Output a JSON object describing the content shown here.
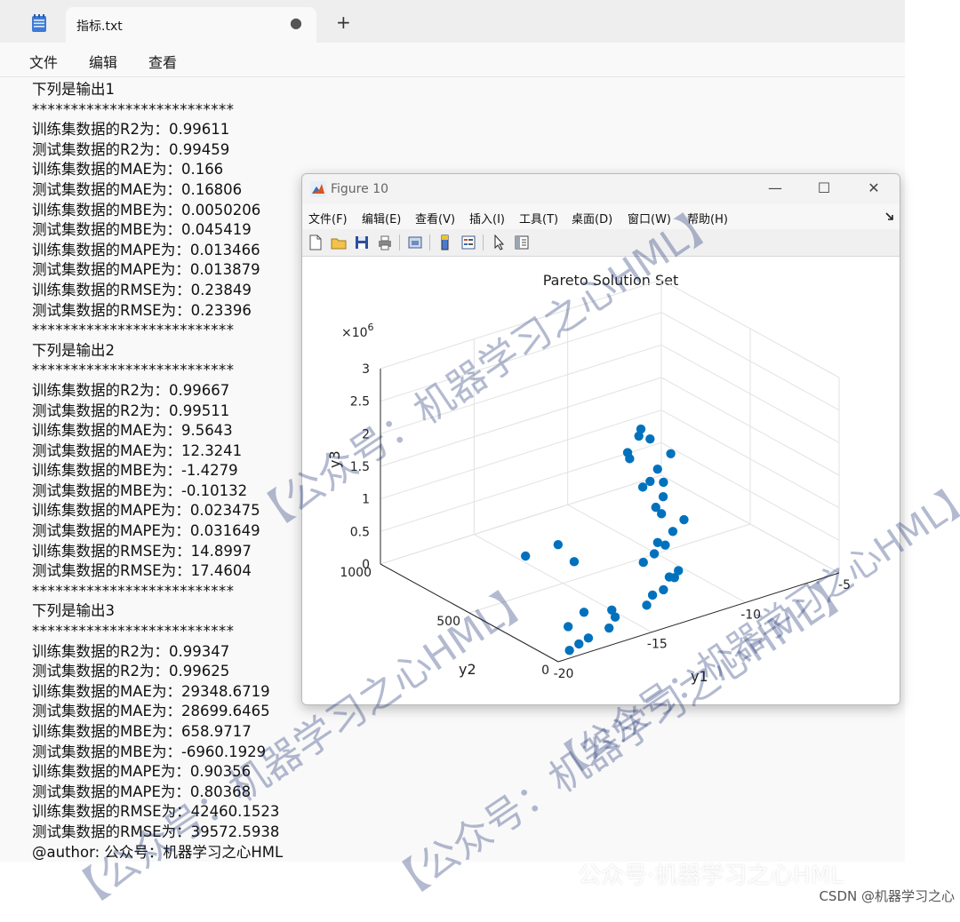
{
  "notepad": {
    "tab_title": "指标.txt",
    "unsaved_dot": "●",
    "new_tab": "+",
    "menu": [
      "文件",
      "编辑",
      "查看"
    ],
    "lines": [
      "下列是输出1",
      "**************************",
      "训练集数据的R2为：0.99611",
      "测试集数据的R2为：0.99459",
      "训练集数据的MAE为：0.166",
      "测试集数据的MAE为：0.16806",
      "训练集数据的MBE为：0.0050206",
      "测试集数据的MBE为：0.045419",
      "训练集数据的MAPE为：0.013466",
      "测试集数据的MAPE为：0.013879",
      "训练集数据的RMSE为：0.23849",
      "测试集数据的RMSE为：0.23396",
      "**************************",
      "下列是输出2",
      "**************************",
      "训练集数据的R2为：0.99667",
      "测试集数据的R2为：0.99511",
      "训练集数据的MAE为：9.5643",
      "测试集数据的MAE为：12.3241",
      "训练集数据的MBE为：-1.4279",
      "测试集数据的MBE为：-0.10132",
      "训练集数据的MAPE为：0.023475",
      "测试集数据的MAPE为：0.031649",
      "训练集数据的RMSE为：14.8997",
      "测试集数据的RMSE为：17.4604",
      "**************************",
      "下列是输出3",
      "**************************",
      "训练集数据的R2为：0.99347",
      "测试集数据的R2为：0.99625",
      "训练集数据的MAE为：29348.6719",
      "测试集数据的MAE为：28699.6465",
      "训练集数据的MBE为：658.9717",
      "测试集数据的MBE为：-6960.1929",
      "训练集数据的MAPE为：0.90356",
      "测试集数据的MAPE为：0.80368",
      "训练集数据的RMSE为：42460.1523",
      "测试集数据的RMSE为：39572.5938",
      "@author: 公众号：机器学习之心HML"
    ]
  },
  "figure": {
    "window_title": "Figure 10",
    "menu": [
      "文件(F)",
      "编辑(E)",
      "查看(V)",
      "插入(I)",
      "工具(T)",
      "桌面(D)",
      "窗口(W)",
      "帮助(H)"
    ],
    "controls": {
      "minimize": "—",
      "maximize": "☐",
      "close": "✕"
    },
    "marker_color": "#0072BD"
  },
  "chart_data": {
    "type": "scatter",
    "title": "Pareto Solution Set",
    "xlabel": "y1",
    "ylabel": "y2",
    "zlabel": "y3",
    "z_multiplier": "×10^6",
    "z_multiplier_base": "×10",
    "z_multiplier_exp": "6",
    "x_ticks": [
      "-20",
      "-15",
      "-10",
      "-5"
    ],
    "y_ticks": [
      "0",
      "500",
      "1000"
    ],
    "z_ticks": [
      "0",
      "0.5",
      "1",
      "1.5",
      "2",
      "2.5",
      "3"
    ],
    "xlim": [
      -20,
      -5
    ],
    "ylim": [
      0,
      1000
    ],
    "zlim": [
      0,
      3
    ],
    "grid": true,
    "points": [
      [
        -17.2,
        150,
        0.28
      ],
      [
        -16.0,
        120,
        0.25
      ],
      [
        -16.2,
        80,
        0.22
      ],
      [
        -17.0,
        30,
        0.2
      ],
      [
        -18.2,
        20,
        0.17
      ],
      [
        -18.8,
        10,
        0.15
      ],
      [
        -19.4,
        0,
        0.12
      ],
      [
        -18.9,
        60,
        0.35
      ],
      [
        -14.8,
        50,
        0.32
      ],
      [
        -14.3,
        70,
        0.4
      ],
      [
        -14.0,
        40,
        0.5
      ],
      [
        -13.5,
        60,
        0.62
      ],
      [
        -13.2,
        40,
        0.72
      ],
      [
        -13.6,
        20,
        0.68
      ],
      [
        -17.0,
        500,
        0.6
      ],
      [
        -16.3,
        300,
        0.75
      ],
      [
        -16.4,
        380,
        0.9
      ],
      [
        -14.6,
        90,
        0.9
      ],
      [
        -14.3,
        60,
        1.05
      ],
      [
        -14.0,
        30,
        1.2
      ],
      [
        -14.5,
        20,
        1.3
      ],
      [
        -13.5,
        40,
        1.35
      ],
      [
        -13.0,
        30,
        1.5
      ],
      [
        -14.2,
        30,
        1.7
      ],
      [
        -14.6,
        20,
        1.85
      ],
      [
        -14.3,
        10,
        2.0
      ],
      [
        -14.0,
        40,
        2.15
      ],
      [
        -15.2,
        30,
        2.2
      ],
      [
        -15.0,
        10,
        2.3
      ],
      [
        -14.6,
        10,
        2.45
      ],
      [
        -13.8,
        20,
        2.6
      ],
      [
        -15.9,
        30,
        2.7
      ],
      [
        -16.2,
        10,
        2.85
      ],
      [
        -15.0,
        10,
        2.95
      ],
      [
        -15.6,
        10,
        3.05
      ],
      [
        -15.3,
        30,
        3.1
      ]
    ]
  },
  "watermarks": {
    "w1": "【公众号：机器学习之心HML】",
    "w2": "【公众号：机器学习之心HML】",
    "w3": "【公众号：机器学习之心HML】",
    "w4": "【公众号：机器学习之心HML】",
    "bottom": "公众号·机器学习之心HML",
    "csdn": "CSDN @机器学习之心"
  }
}
